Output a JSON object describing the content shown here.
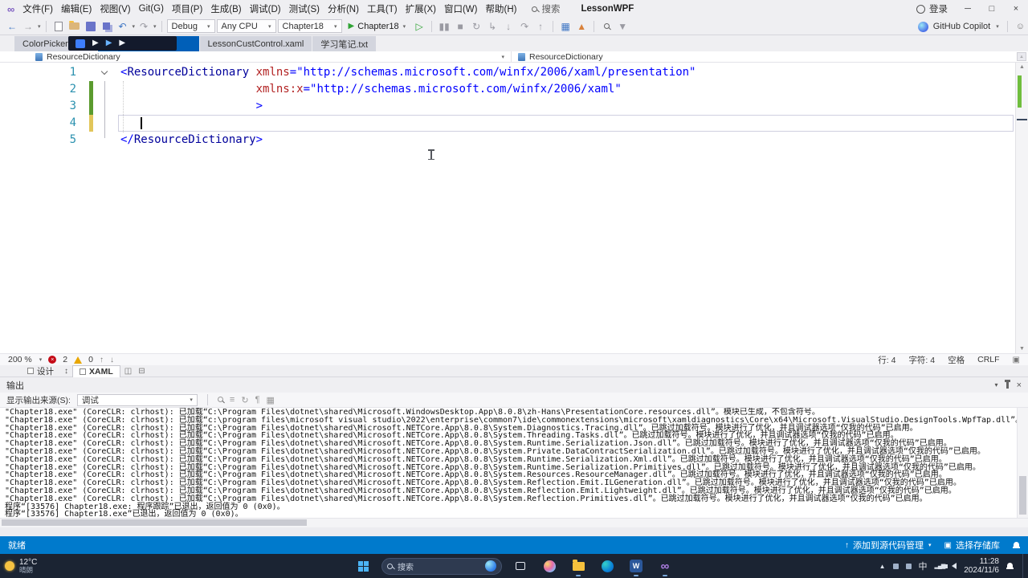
{
  "window": {
    "title": "LessonWPF",
    "signin": "登录"
  },
  "menubar": {
    "items": [
      "文件(F)",
      "编辑(E)",
      "视图(V)",
      "Git(G)",
      "项目(P)",
      "生成(B)",
      "调试(D)",
      "测试(S)",
      "分析(N)",
      "工具(T)",
      "扩展(X)",
      "窗口(W)",
      "帮助(H)"
    ],
    "search": "搜索"
  },
  "toolbar": {
    "configuration": "Debug",
    "platform": "Any CPU",
    "startup_project": "Chapter18",
    "run_label": "Chapter18",
    "copilot_label": "GitHub Copilot"
  },
  "tabs": [
    {
      "label": "ColorPicker.xaml",
      "active": false
    },
    {
      "label": "",
      "active": true
    },
    {
      "label": "LessonCustControl.xaml",
      "active": false
    },
    {
      "label": "学习笔记.txt",
      "active": false
    }
  ],
  "navbar": {
    "left_dropdown": "ResourceDictionary",
    "right_dropdown": "ResourceDictionary"
  },
  "editor": {
    "lines": [
      {
        "num": "1",
        "fold": true,
        "segments": [
          [
            "d",
            "<"
          ],
          [
            "e",
            "ResourceDictionary"
          ],
          [
            "p",
            " "
          ],
          [
            "a",
            "xmlns"
          ],
          [
            "d",
            "="
          ],
          [
            "s",
            "\"http://schemas.microsoft.com/winfx/2006/xaml/presentation\""
          ]
        ]
      },
      {
        "num": "2",
        "change": "green",
        "segments": [
          [
            "p",
            "                    "
          ],
          [
            "a",
            "xmlns:x"
          ],
          [
            "d",
            "="
          ],
          [
            "s",
            "\"http://schemas.microsoft.com/winfx/2006/xaml\""
          ]
        ]
      },
      {
        "num": "3",
        "change": "green",
        "segments": [
          [
            "p",
            "                    "
          ],
          [
            "d",
            ">"
          ]
        ]
      },
      {
        "num": "4",
        "change": "yellow",
        "current": true,
        "segments": []
      },
      {
        "num": "5",
        "segments": [
          [
            "d",
            "</"
          ],
          [
            "e",
            "ResourceDictionary"
          ],
          [
            "d",
            ">"
          ]
        ]
      }
    ],
    "status": {
      "zoom": "200 %",
      "errors": "2",
      "warnings": "0",
      "line": "行: 4",
      "column": "字符: 4",
      "spaces": "空格",
      "eol": "CRLF"
    },
    "design_tab": "设计",
    "xaml_tab": "XAML"
  },
  "output": {
    "title": "输出",
    "source_label": "显示输出来源(S):",
    "source_value": "调试",
    "lines": [
      "\"Chapter18.exe\" (CoreCLR: clrhost): 已加载“C:\\Program Files\\dotnet\\shared\\Microsoft.WindowsDesktop.App\\8.0.8\\zh-Hans\\PresentationCore.resources.dll”。模块已生成，不包含符号。",
      "\"Chapter18.exe\" (CoreCLR: clrhost): 已加载“c:\\program files\\microsoft visual studio\\2022\\enterprise\\common7\\ide\\commonextensions\\microsoft\\xamldiagnostics\\Core\\x64\\Microsoft.VisualStudio.DesignTools.WpfTap.dll”。已跳过加载符号。模块进行了优化，并且调试器选项“仅我的代码”已启用。",
      "\"Chapter18.exe\" (CoreCLR: clrhost): 已加载“C:\\Program Files\\dotnet\\shared\\Microsoft.NETCore.App\\8.0.8\\System.Diagnostics.Tracing.dll”。已跳过加载符号。模块进行了优化，并且调试器选项“仅我的代码”已启用。",
      "\"Chapter18.exe\" (CoreCLR: clrhost): 已加载“C:\\Program Files\\dotnet\\shared\\Microsoft.NETCore.App\\8.0.8\\System.Threading.Tasks.dll”。已跳过加载符号。模块进行了优化，并且调试器选项“仅我的代码”已启用。",
      "\"Chapter18.exe\" (CoreCLR: clrhost): 已加载“C:\\Program Files\\dotnet\\shared\\Microsoft.NETCore.App\\8.0.8\\System.Runtime.Serialization.Json.dll”。已跳过加载符号。模块进行了优化，并且调试器选项“仅我的代码”已启用。",
      "\"Chapter18.exe\" (CoreCLR: clrhost): 已加载“C:\\Program Files\\dotnet\\shared\\Microsoft.NETCore.App\\8.0.8\\System.Private.DataContractSerialization.dll”。已跳过加载符号。模块进行了优化，并且调试器选项“仅我的代码”已启用。",
      "\"Chapter18.exe\" (CoreCLR: clrhost): 已加载“C:\\Program Files\\dotnet\\shared\\Microsoft.NETCore.App\\8.0.8\\System.Runtime.Serialization.Xml.dll”。已跳过加载符号。模块进行了优化，并且调试器选项“仅我的代码”已启用。",
      "\"Chapter18.exe\" (CoreCLR: clrhost): 已加载“C:\\Program Files\\dotnet\\shared\\Microsoft.NETCore.App\\8.0.8\\System.Runtime.Serialization.Primitives.dll”。已跳过加载符号。模块进行了优化，并且调试器选项“仅我的代码”已启用。",
      "\"Chapter18.exe\" (CoreCLR: clrhost): 已加载“C:\\Program Files\\dotnet\\shared\\Microsoft.NETCore.App\\8.0.8\\System.Resources.ResourceManager.dll”。已跳过加载符号。模块进行了优化，并且调试器选项“仅我的代码”已启用。",
      "\"Chapter18.exe\" (CoreCLR: clrhost): 已加载“C:\\Program Files\\dotnet\\shared\\Microsoft.NETCore.App\\8.0.8\\System.Reflection.Emit.ILGeneration.dll”。已跳过加载符号。模块进行了优化，并且调试器选项“仅我的代码”已启用。",
      "\"Chapter18.exe\" (CoreCLR: clrhost): 已加载“C:\\Program Files\\dotnet\\shared\\Microsoft.NETCore.App\\8.0.8\\System.Reflection.Emit.Lightweight.dll”。已跳过加载符号。模块进行了优化，并且调试器选项“仅我的代码”已启用。",
      "\"Chapter18.exe\" (CoreCLR: clrhost): 已加载“C:\\Program Files\\dotnet\\shared\\Microsoft.NETCore.App\\8.0.8\\System.Reflection.Primitives.dll”。已跳过加载符号。模块进行了优化，并且调试器选项“仅我的代码”已启用。",
      "程序“[33576] Chapter18.exe: 程序跟踪”已退出，返回值为 0 (0x0)。",
      "程序“[33576] Chapter18.exe”已退出，返回值为 0 (0x0)。"
    ]
  },
  "statusbar": {
    "ready": "就绪",
    "add_source_control": "添加到源代码管理",
    "select_repository": "选择存储库"
  },
  "taskbar": {
    "weather_temp": "12°C",
    "weather_desc": "晴朗",
    "search": "搜索",
    "ime": "中",
    "time": "11:28",
    "date": "2024/11/6"
  },
  "colors": {
    "active_tab_blue": "#005FB8",
    "status_bar_blue": "#007ACC",
    "error_red": "#C50B17",
    "warning_yellow": "#E9A700",
    "change_saved_green": "#5B9B2E",
    "change_unsaved_yellow": "#E2C65A",
    "run_green": "#2FA334"
  },
  "icon_names": [
    "search-icon",
    "save-icon",
    "save-all-icon",
    "open-folder-icon",
    "new-file-icon",
    "undo-icon",
    "redo-icon",
    "run-icon",
    "error-icon",
    "warning-icon",
    "pin-icon",
    "close-icon",
    "bell-icon",
    "windows-start-icon",
    "file-explorer-icon",
    "edge-icon",
    "word-icon",
    "visual-studio-icon",
    "copilot-icon",
    "speaker-icon",
    "network-icon",
    "ime-icon",
    "person-icon"
  ]
}
